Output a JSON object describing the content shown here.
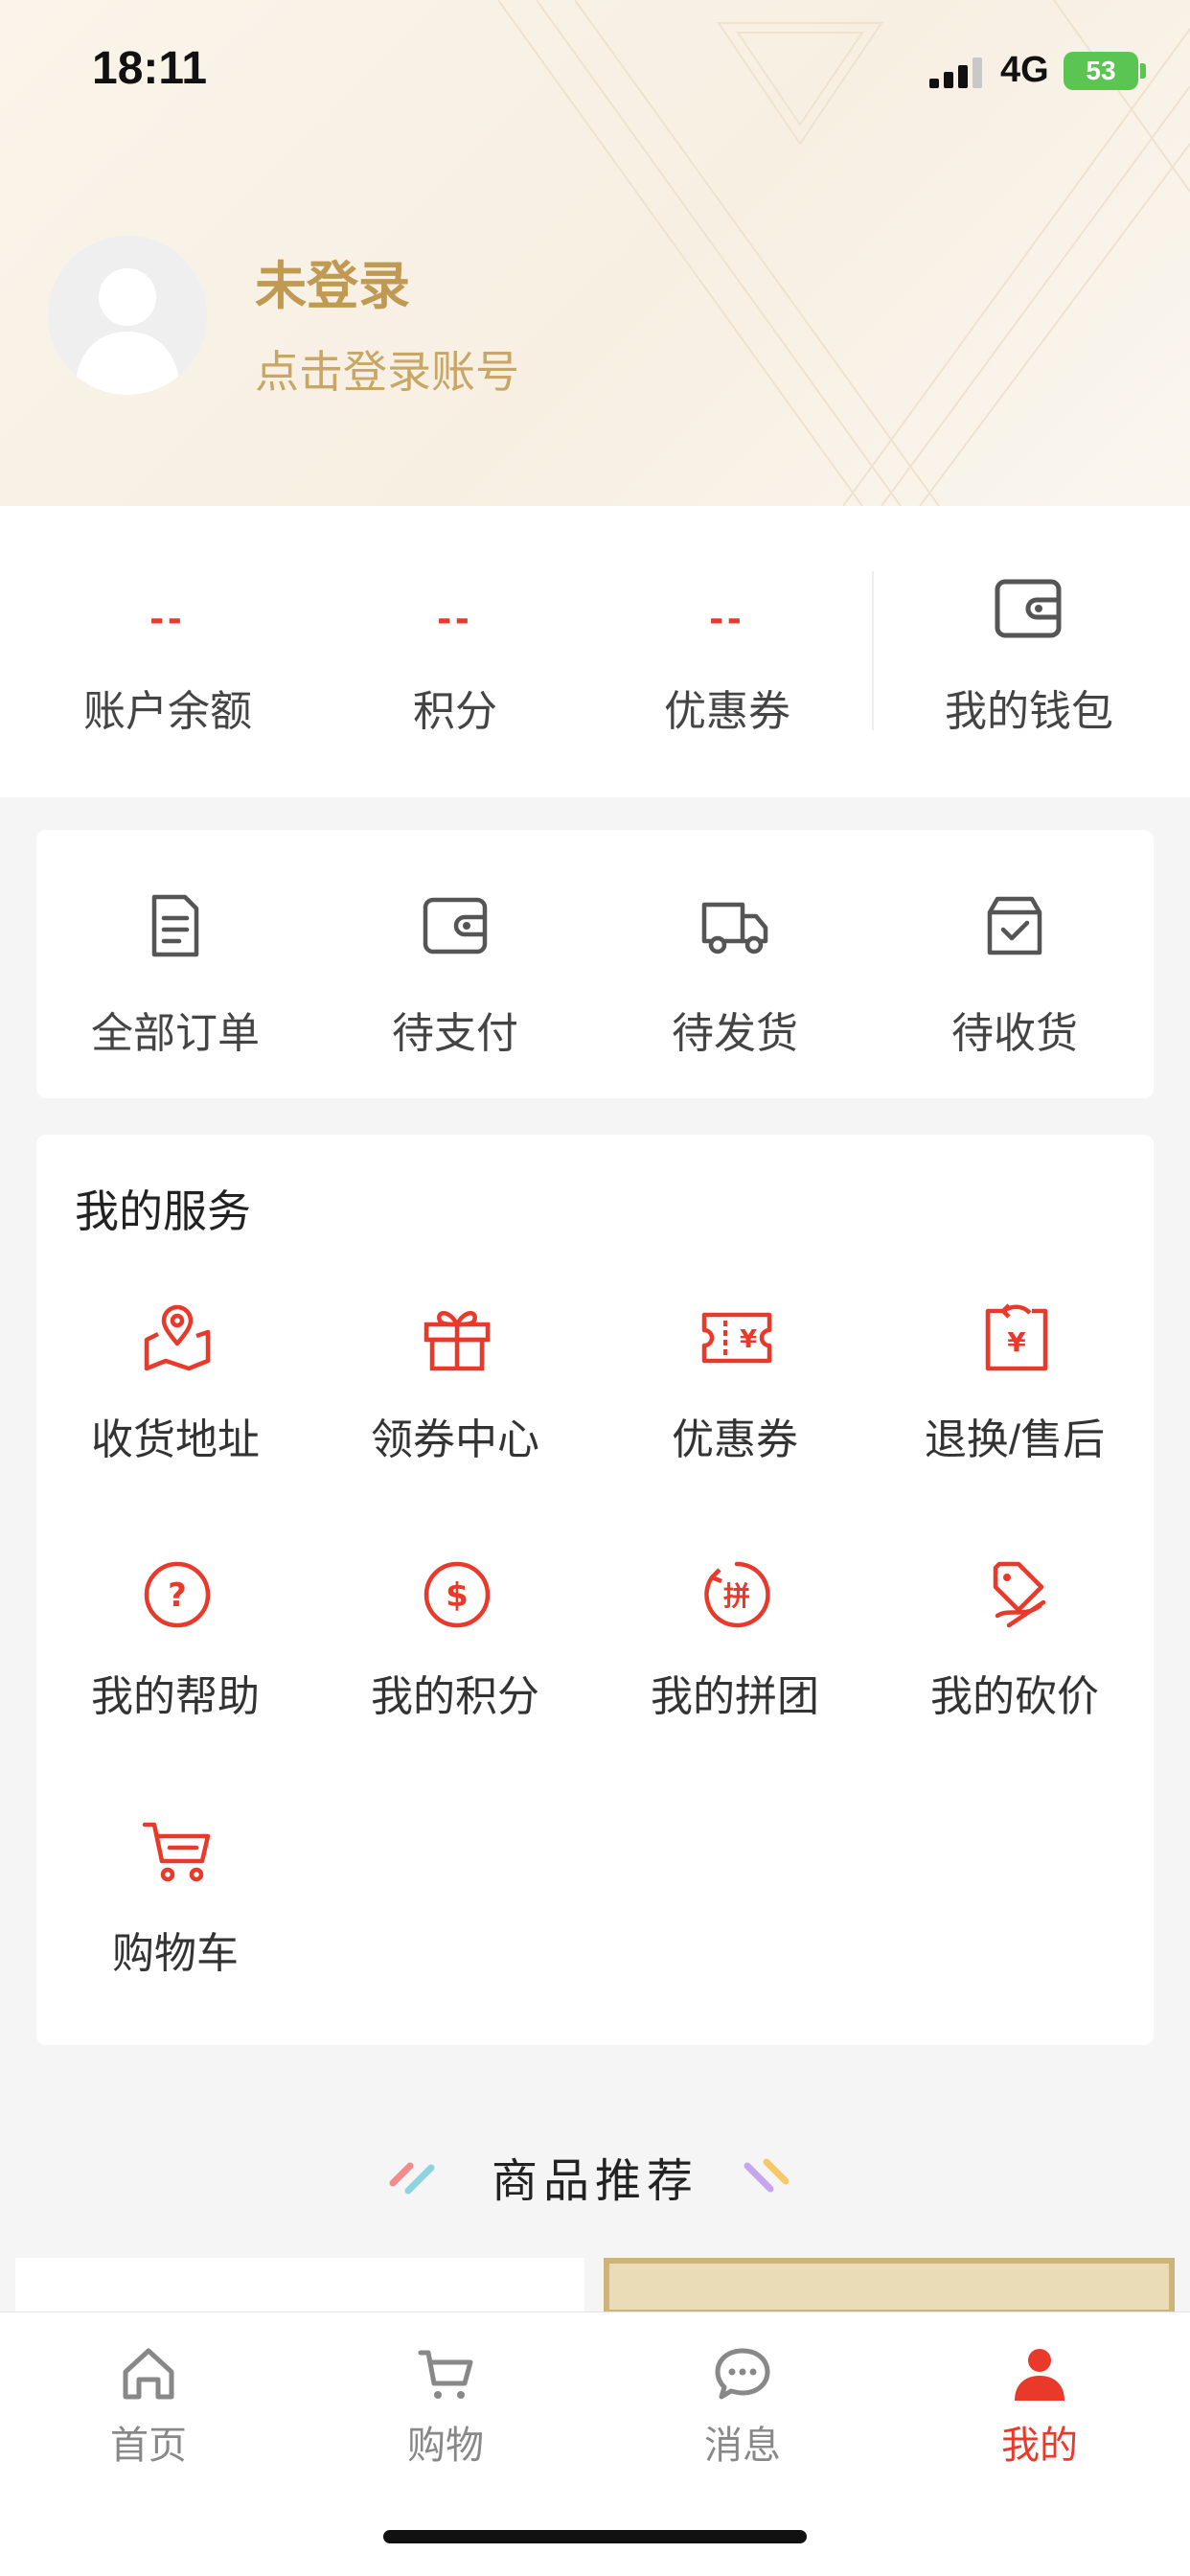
{
  "status_bar": {
    "time": "18:11",
    "network": "4G",
    "battery": "53"
  },
  "profile": {
    "name": "未登录",
    "hint": "点击登录账号"
  },
  "account_stats": [
    {
      "value": "--",
      "label": "账户余额"
    },
    {
      "value": "--",
      "label": "积分"
    },
    {
      "value": "--",
      "label": "优惠券"
    }
  ],
  "wallet": {
    "label": "我的钱包",
    "icon": "wallet-icon"
  },
  "orders": [
    {
      "label": "全部订单",
      "icon": "order-list-icon"
    },
    {
      "label": "待支付",
      "icon": "wallet-icon"
    },
    {
      "label": "待发货",
      "icon": "truck-icon"
    },
    {
      "label": "待收货",
      "icon": "box-check-icon"
    }
  ],
  "services": {
    "title": "我的服务",
    "items": [
      {
        "label": "收货地址",
        "icon": "location-map-icon"
      },
      {
        "label": "领券中心",
        "icon": "gift-icon"
      },
      {
        "label": "优惠券",
        "icon": "coupon-icon"
      },
      {
        "label": "退换/售后",
        "icon": "refund-icon"
      },
      {
        "label": "我的帮助",
        "icon": "help-icon"
      },
      {
        "label": "我的积分",
        "icon": "dollar-icon"
      },
      {
        "label": "我的拼团",
        "icon": "group-buy-icon"
      },
      {
        "label": "我的砍价",
        "icon": "bargain-tag-icon"
      },
      {
        "label": "购物车",
        "icon": "cart-icon"
      }
    ]
  },
  "recommend": {
    "title": "商品推荐"
  },
  "tabbar": [
    {
      "label": "首页",
      "icon": "home-icon"
    },
    {
      "label": "购物",
      "icon": "cart-icon"
    },
    {
      "label": "消息",
      "icon": "chat-icon"
    },
    {
      "label": "我的",
      "icon": "user-icon",
      "active": true
    }
  ],
  "colors": {
    "accent": "#e8392a",
    "gold": "#c09a52",
    "text": "#333333",
    "inactive": "#888888"
  }
}
